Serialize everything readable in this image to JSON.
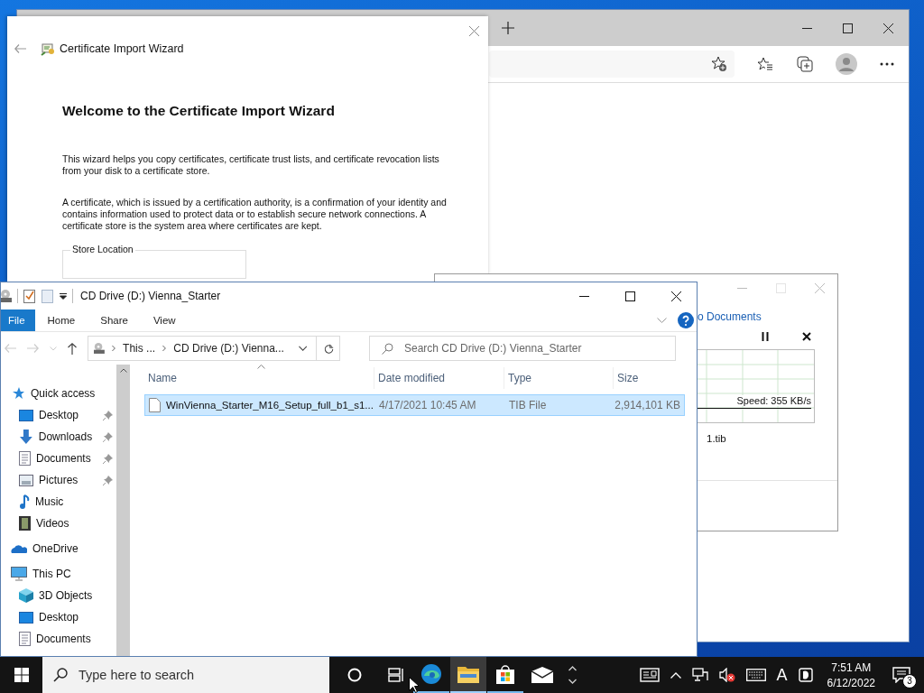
{
  "certificate_wizard": {
    "title": "Certificate Import Wizard",
    "heading": "Welcome to the Certificate Import Wizard",
    "paragraphs": [
      "This wizard helps you copy certificates, certificate trust lists, and certificate revocation lists from your disk to a certificate store.",
      "A certificate, which is issued by a certification authority, is a confirmation of your identity and contains information used to protect data or to establish secure network connections. A certificate store is the system area where certificates are kept."
    ],
    "group_label": "Store Location"
  },
  "copy_dialog": {
    "link": "o Documents",
    "speed": "Speed: 355 KB/s",
    "file": "1.tib"
  },
  "explorer": {
    "title": "CD Drive (D:) Vienna_Starter",
    "ribbon_tabs": [
      {
        "label": "File",
        "selected": true
      },
      {
        "label": "Home",
        "selected": false
      },
      {
        "label": "Share",
        "selected": false
      },
      {
        "label": "View",
        "selected": false
      }
    ],
    "address_crumbs": [
      "This ...",
      "CD Drive (D:) Vienna..."
    ],
    "search": {
      "placeholder": "Search CD Drive (D:) Vienna_Starter"
    },
    "columns": [
      "Name",
      "Date modified",
      "Type",
      "Size"
    ],
    "rows": [
      {
        "name": "WinVienna_Starter_M16_Setup_full_b1_s1...",
        "date": "4/17/2021 10:45 AM",
        "type": "TIB File",
        "size": "2,914,101 KB",
        "selected": true
      }
    ],
    "nav": [
      {
        "label": "Quick access",
        "kind": "star",
        "children": [
          {
            "label": "Desktop",
            "kind": "desktop",
            "pinned": true
          },
          {
            "label": "Downloads",
            "kind": "download",
            "pinned": true
          },
          {
            "label": "Documents",
            "kind": "document",
            "pinned": true
          },
          {
            "label": "Pictures",
            "kind": "pictures",
            "pinned": true
          },
          {
            "label": "Music",
            "kind": "music",
            "pinned": false
          },
          {
            "label": "Videos",
            "kind": "video",
            "pinned": false
          }
        ]
      },
      {
        "label": "OneDrive",
        "kind": "cloud"
      },
      {
        "label": "This PC",
        "kind": "pc",
        "children": [
          {
            "label": "3D Objects",
            "kind": "cube",
            "pinned": false
          },
          {
            "label": "Desktop",
            "kind": "desktop",
            "pinned": false
          },
          {
            "label": "Documents",
            "kind": "document",
            "pinned": false
          }
        ]
      }
    ]
  },
  "taskbar": {
    "search_placeholder": "Type here to search",
    "apps": [
      {
        "kind": "edge",
        "running": true,
        "active": false
      },
      {
        "kind": "folder",
        "running": true,
        "active": true
      },
      {
        "kind": "store",
        "running": true,
        "active": false
      },
      {
        "kind": "mail",
        "running": false,
        "active": false
      }
    ],
    "input_indicator": "A",
    "time": "7:51 AM",
    "date": "6/12/2022",
    "notification_count": "3"
  }
}
